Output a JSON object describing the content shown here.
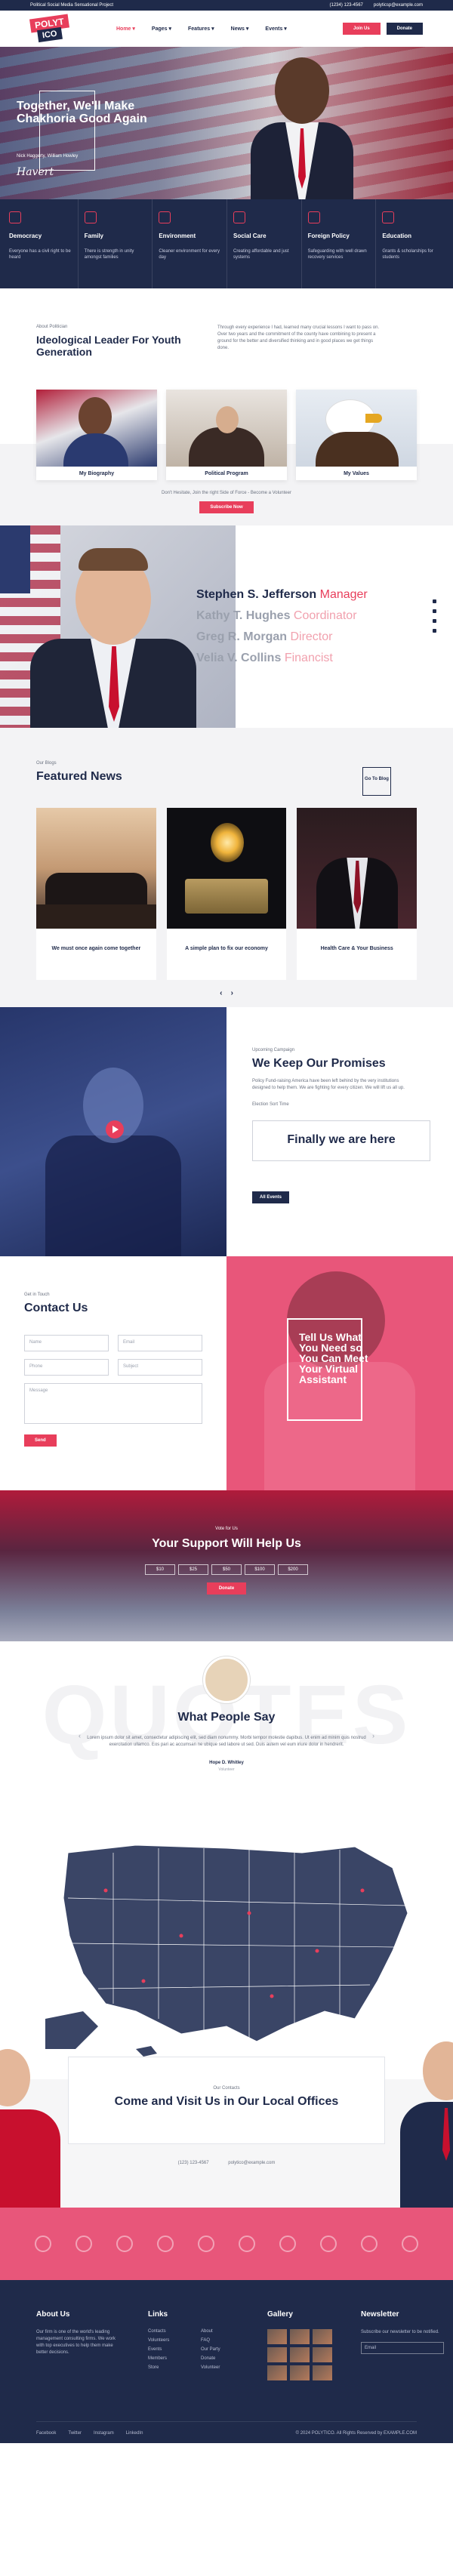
{
  "topbar": {
    "left": "Political Social Media Sensational Project",
    "email": "polyticsp@example.com",
    "phone": "(1234) 123-4567"
  },
  "header": {
    "logo_top": "POLYT",
    "logo_bottom": "ICO",
    "nav": [
      "Home ▾",
      "Pages ▾",
      "Features ▾",
      "News ▾",
      "Events ▾"
    ],
    "join_label": "Join Us",
    "donate_label": "Donate"
  },
  "hero": {
    "title": "Together, We'll Make Chakhoria Good Again",
    "byline": "Nick Haggerty, William Howley",
    "signature": "Havert"
  },
  "features": [
    {
      "title": "Democracy",
      "text": "Everyone has a civil right to be heard"
    },
    {
      "title": "Family",
      "text": "There is strength in unity amongst families"
    },
    {
      "title": "Environment",
      "text": "Cleaner environment for every day"
    },
    {
      "title": "Social Care",
      "text": "Creating affordable and just systems"
    },
    {
      "title": "Foreign Policy",
      "text": "Safeguarding with well drawn recovery services"
    },
    {
      "title": "Education",
      "text": "Grants & scholarships for students"
    }
  ],
  "about": {
    "kicker": "About Politician",
    "title": "Ideological Leader For Youth Generation",
    "text": "Through every experience I had, learned many crucial lessons I want to pass on. Over two years and the commitment of the county have combining to present a ground for the better and diversified thinking and in good places we get things done."
  },
  "cards": [
    {
      "label": "My Biography"
    },
    {
      "label": "Political Program"
    },
    {
      "label": "My Values"
    }
  ],
  "join": {
    "text": "Don't Hesitate, Join the right Side of Force - Become a Volunteer",
    "button": "Subscribe Now"
  },
  "team": [
    {
      "name": "Stephen S. Jefferson",
      "role": "Manager"
    },
    {
      "name": "Kathy T. Hughes",
      "role": "Coordinator"
    },
    {
      "name": "Greg R. Morgan",
      "role": "Director"
    },
    {
      "name": "Velia V. Collins",
      "role": "Financist"
    }
  ],
  "news": {
    "kicker": "Our Blogs",
    "title": "Featured News",
    "seeall": "Go To Blog",
    "items": [
      {
        "title": "We must once again come together"
      },
      {
        "title": "A simple plan to fix our economy"
      },
      {
        "title": "Health Care & Your Business"
      }
    ],
    "prev": "‹",
    "next": "›"
  },
  "promise": {
    "kicker": "Upcoming Campaign",
    "title": "We Keep Our Promises",
    "text": "Policy Fund-raising America have been left behind by the very institutions designed to help them. We are fighting for every citizen. We will lift us all up.",
    "subtitle": "Election Sort Time",
    "here": "Finally we are here",
    "button": "All Events"
  },
  "contact": {
    "kicker": "Get in Touch",
    "title": "Contact Us",
    "name": "Name",
    "email": "Email",
    "phone": "Phone",
    "subject": "Subject",
    "message": "Message",
    "send": "Send",
    "tell": "Tell Us What You Need so You Can Meet Your Virtual Assistant"
  },
  "support": {
    "kicker": "Vote for Us",
    "title": "Your Support Will Help Us",
    "amounts": [
      "$10",
      "$25",
      "$50",
      "$100",
      "$200"
    ],
    "donate": "Donate"
  },
  "testimonial": {
    "bg": "QUOTES",
    "title": "What People Say",
    "quote": "Lorem ipsum dolor sit amet, consectetur adipiscing elit, sed diam nonummy. Morbi tempor molestie dapibus. Ut enim ad minim quis nostrud exercitation ullamco. Eos pari ac accumsan ne ubique sed labore ut sed. Duis autem vel eum iriure dolor in hendrerit.",
    "name": "Hope D. Whitley",
    "role": "Volunteer",
    "prev": "‹",
    "next": "›"
  },
  "offices": {
    "kicker": "Our Contacts",
    "title": "Come and Visit Us in Our Local Offices",
    "phone": "(123) 123-4567",
    "email": "polytico@example.com"
  },
  "footer": {
    "about_h": "About Us",
    "about_t": "Our firm is one of the world's leading management consulting firms. We work with top executives to help them make better decisions.",
    "links_h": "Links",
    "links": [
      "Contacts",
      "Volunteers",
      "Events",
      "Members",
      "Store",
      "About",
      "FAQ",
      "Our Party",
      "Donate",
      "Volunteer"
    ],
    "gallery_h": "Gallery",
    "news_h": "Newsletter",
    "news_t": "Subscribe our newsletter to be notified.",
    "email_ph": "Email",
    "social": [
      "Facebook",
      "Twitter",
      "Instagram",
      "LinkedIn"
    ],
    "copy": "© 2024 POLYTICO. All Rights Reserved by EXAMPLE.COM"
  }
}
